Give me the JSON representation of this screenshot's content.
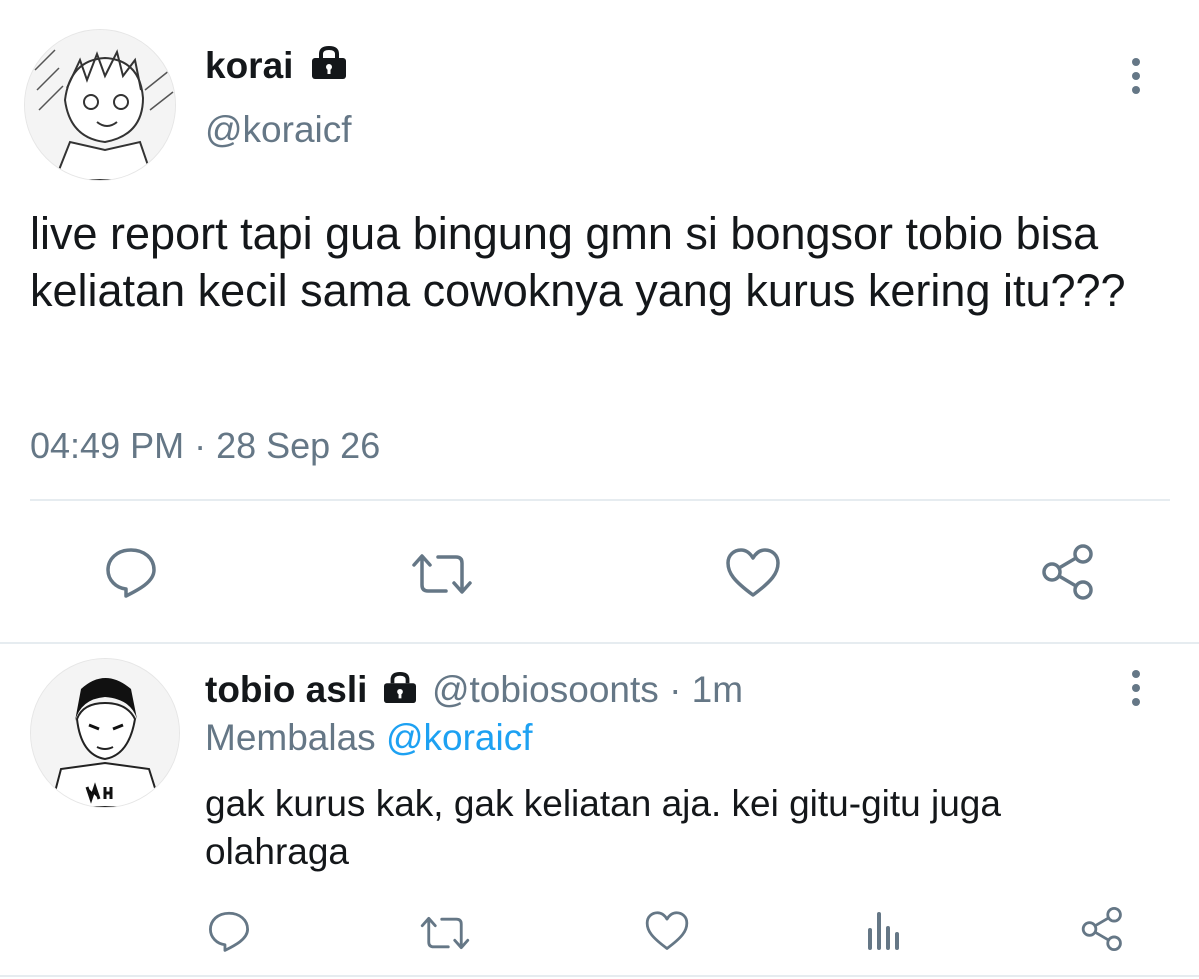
{
  "main_tweet": {
    "display_name": "korai",
    "handle": "@koraicf",
    "text": "live report tapi gua bingung gmn si bongsor tobio bisa keliatan kecil sama cowoknya yang kurus kering itu???",
    "timestamp": "04:49 PM · 28 Sep 26"
  },
  "reply": {
    "display_name": "tobio asli",
    "handle": "@tobiosoonts",
    "time_ago": "· 1m",
    "replying_prefix": "Membalas",
    "replying_to": "@koraicf",
    "text": "gak kurus kak, gak keliatan aja. kei gitu-gitu juga olahraga"
  },
  "icons": {
    "reply": "reply-icon",
    "retweet": "retweet-icon",
    "like": "heart-icon",
    "share": "share-icon",
    "analytics": "analytics-icon",
    "more": "more-vertical-icon",
    "lock": "lock-icon"
  },
  "colors": {
    "text": "#14171a",
    "muted": "#657786",
    "link": "#1da1f2",
    "divider": "#e6ecf0"
  }
}
